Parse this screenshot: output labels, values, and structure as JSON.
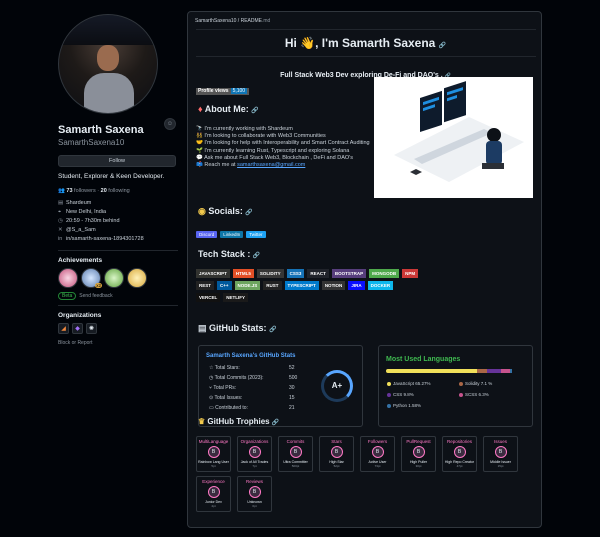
{
  "profile": {
    "avatar_badge": "☺",
    "fullname": "Samarth Saxena",
    "handle": "SamarthSaxena10",
    "follow_label": "Follow",
    "bio": "Student, Explorer & Keen Developer.",
    "followers_count": "73",
    "followers_label": "followers",
    "following_count": "20",
    "following_label": "following",
    "separator": " · ",
    "meta": [
      {
        "icon": "building-icon",
        "glyph": "▤",
        "text": "Shardeum"
      },
      {
        "icon": "location-icon",
        "glyph": "⌖",
        "text": "New Delhi, India"
      },
      {
        "icon": "clock-icon",
        "glyph": "◷",
        "text": "20:59 - 7h30m behind"
      },
      {
        "icon": "twitter-icon",
        "glyph": "✕",
        "text": "@S_a_Sam"
      },
      {
        "icon": "linkedin-icon",
        "glyph": "in",
        "text": "in/samarth-saxena-1894301728"
      }
    ],
    "achievements_title": "Achievements",
    "achievement_badge_count": "x2",
    "beta_tag": "Beta",
    "beta_text": "Send feedback",
    "organizations_title": "Organizations",
    "block_text": "Block or Report"
  },
  "readme": {
    "breadcrumb_owner": "SamarthSaxena10 / README",
    "breadcrumb_suffix": ".md",
    "title": "Hi 👋, I'm Samarth Saxena",
    "link_icon": "🔗",
    "subtitle": "Full Stack Web3 Dev exploring De-Fi and DAO's .",
    "views_label": "Profile views",
    "views_count": "5,100",
    "about_title": "About Me:",
    "about_lines": [
      "🔭 I'm currently working with Shardeum",
      "👯 I'm looking to collaborate with Web3 Communities",
      "🤝 I'm looking for help with Interoperability and Smart Contract Auditing",
      "🌱 I'm currently learning Rust, Typescript and exploring Solana",
      "💬 Ask me about Full Stack Web3, Blockchain , DeFi and DAO's",
      "📫 Reach me at"
    ],
    "email": "samarthsaxena@gmail.com",
    "socials_title": "Socials:",
    "socials": [
      "Discord",
      "LinkedIn",
      "Twitter"
    ],
    "tech_title": "Tech Stack :",
    "tech": [
      [
        {
          "t": "JAVASCRIPT",
          "c": "#323330"
        },
        {
          "t": "HTML5",
          "c": "#e34f26"
        },
        {
          "t": "SOLIDITY",
          "c": "#363636"
        },
        {
          "t": "CSS3",
          "c": "#1572b6"
        },
        {
          "t": "REACT",
          "c": "#20232a"
        },
        {
          "t": "BOOTSTRAP",
          "c": "#563d7c"
        },
        {
          "t": "MONGODB",
          "c": "#4ea94b"
        },
        {
          "t": "NPM",
          "c": "#cb3837"
        }
      ],
      [
        {
          "t": "REST",
          "c": "#222222"
        },
        {
          "t": "C++",
          "c": "#00599c"
        },
        {
          "t": "NODE.JS",
          "c": "#6da55f"
        },
        {
          "t": "RUST",
          "c": "#222222"
        },
        {
          "t": "TYPESCRIPT",
          "c": "#007acc"
        },
        {
          "t": "NOTION",
          "c": "#333333"
        },
        {
          "t": "JIRA",
          "c": "#0a0fff"
        },
        {
          "t": "DOCKER",
          "c": "#0db7ed"
        }
      ],
      [
        {
          "t": "VERCEL",
          "c": "#111111"
        },
        {
          "t": "NETLIFY",
          "c": "#1a1a1a"
        }
      ]
    ],
    "stats_title": "GitHub Stats:",
    "stats": {
      "card_title": "Samarth Saxena's GitHub Stats",
      "rows": [
        {
          "label": "Total Stars:",
          "value": "52"
        },
        {
          "label": "Total Commits (2023):",
          "value": "500"
        },
        {
          "label": "Total PRs:",
          "value": "30"
        },
        {
          "label": "Total Issues:",
          "value": "15"
        },
        {
          "label": "Contributed to:",
          "value": "21"
        }
      ],
      "grade": "A+"
    },
    "langs": {
      "title": "Most Used Languages",
      "items": [
        {
          "name": "JavaScript",
          "pct": "65.27%",
          "share": 0.6527,
          "color": "#f1e05a"
        },
        {
          "name": "Solidity",
          "pct": "7.1 %",
          "share": 0.071,
          "color": "#aa6746"
        },
        {
          "name": "CSS",
          "pct": "9.8%",
          "share": 0.098,
          "color": "#663399"
        },
        {
          "name": "SCSS",
          "pct": "6.3%",
          "share": 0.063,
          "color": "#c6538c"
        },
        {
          "name": "Python",
          "pct": "1.58%",
          "share": 0.0158,
          "color": "#3572a5"
        }
      ]
    },
    "trophy_title": "GitHub Trophies",
    "trophies": [
      {
        "title": "MultiLanguage",
        "rank": "B",
        "name": "Rainbow Lang User",
        "sub": "5pt"
      },
      {
        "title": "Organizations",
        "rank": "B",
        "name": "Jack of All Trades",
        "sub": "7pt"
      },
      {
        "title": "Commits",
        "rank": "B",
        "name": "Ultra Committer",
        "sub": "500pt"
      },
      {
        "title": "Stars",
        "rank": "B",
        "name": "High Star",
        "sub": "52pt"
      },
      {
        "title": "Followers",
        "rank": "B",
        "name": "Active User",
        "sub": "73pt"
      },
      {
        "title": "PullRequest",
        "rank": "B",
        "name": "High Puller",
        "sub": "30pt"
      },
      {
        "title": "Repositories",
        "rank": "B",
        "name": "High Repo Creator",
        "sub": "47pt"
      },
      {
        "title": "Issues",
        "rank": "B",
        "name": "Middle Issuer",
        "sub": "15pt"
      },
      {
        "title": "Experience",
        "rank": "B",
        "name": "Junior Dev",
        "sub": "4pt"
      },
      {
        "title": "Reviews",
        "rank": "B",
        "name": "Unknown",
        "sub": "0pt"
      }
    ]
  }
}
